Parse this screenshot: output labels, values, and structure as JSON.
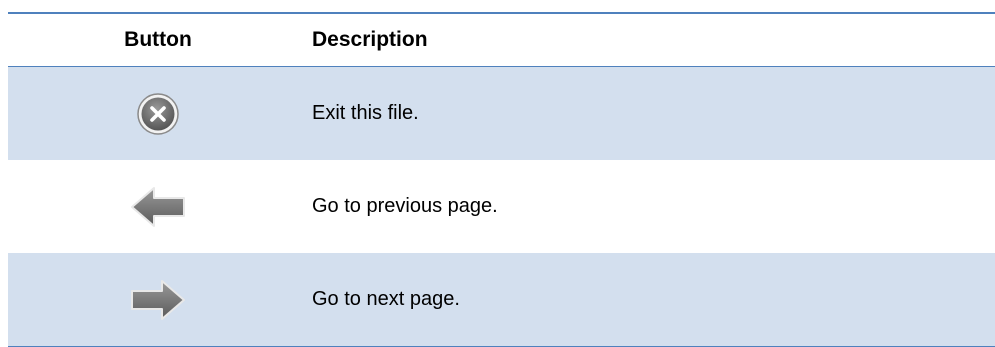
{
  "table": {
    "headers": {
      "button": "Button",
      "description": "Description"
    },
    "rows": [
      {
        "icon": "close-circle-icon",
        "description": "Exit this file."
      },
      {
        "icon": "arrow-left-icon",
        "description": "Go to previous page."
      },
      {
        "icon": "arrow-right-icon",
        "description": "Go to next page."
      }
    ]
  },
  "colors": {
    "rule": "#4f81bd",
    "shaded_row": "#d3dfee",
    "icon_gray": "#707070"
  }
}
